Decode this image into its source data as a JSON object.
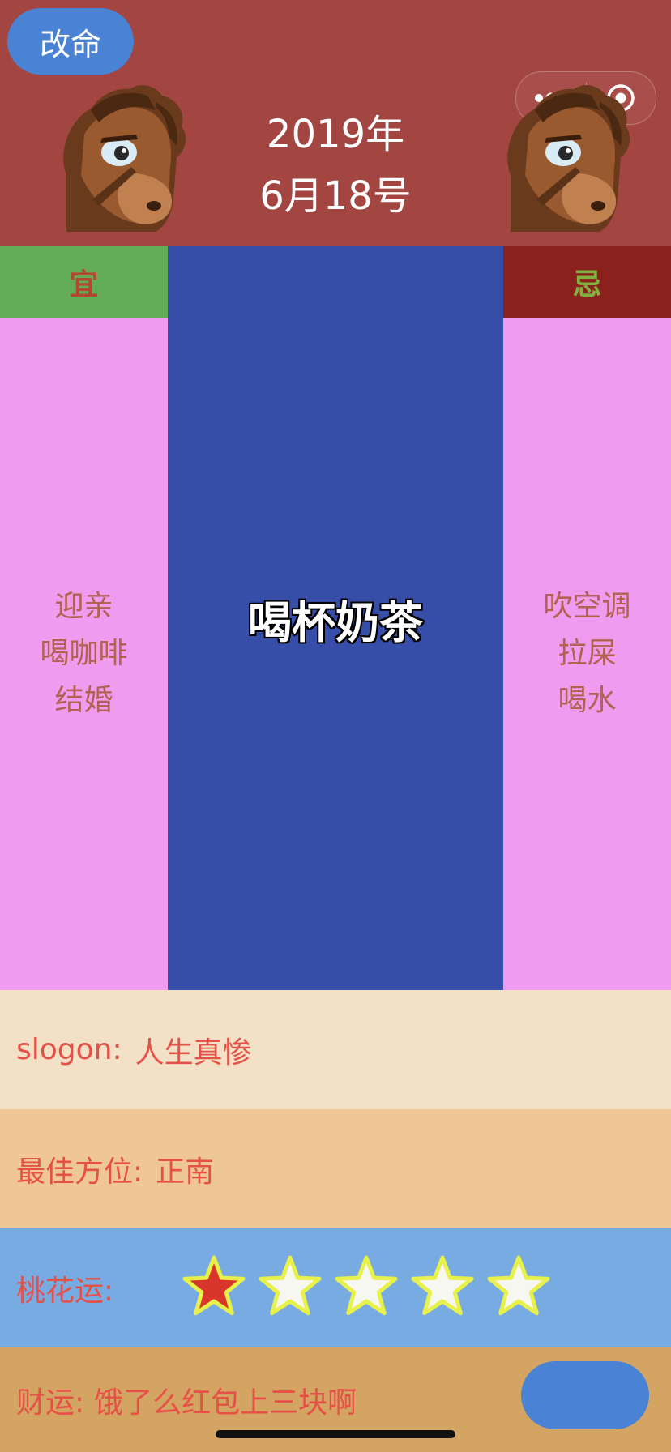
{
  "header": {
    "change_button": "改命",
    "year": "2019年",
    "day": "6月18号"
  },
  "columns": {
    "yi_label": "宜",
    "ji_label": "忌",
    "yi_items": [
      "迎亲",
      "喝咖啡",
      "结婚"
    ],
    "ji_items": [
      "吹空调",
      "拉屎",
      "喝水"
    ],
    "center_text": "喝杯奶茶"
  },
  "info": {
    "slogon_label": "slogon:",
    "slogon_value": "人生真惨",
    "direction_label": "最佳方位:",
    "direction_value": "正南",
    "love_label": "桃花运:",
    "love_rating": 1,
    "love_max": 5,
    "wealth_label": "财运:",
    "wealth_value": "饿了么红包上三块啊"
  },
  "icons": {
    "menu": "more-dots-icon",
    "close": "target-circle-icon",
    "horse": "horse-head-icon",
    "star": "star-icon"
  },
  "colors": {
    "header_bg": "#a34541",
    "yi_bg": "#63ad5a",
    "ji_bg": "#8b211d",
    "columns_bg": "#ee9bf0",
    "center_bg": "#374ea8",
    "button_blue": "#4a82d4",
    "star_filled": "#d8362a",
    "star_empty": "#f7f7f2",
    "star_outline": "#e8f04a"
  }
}
